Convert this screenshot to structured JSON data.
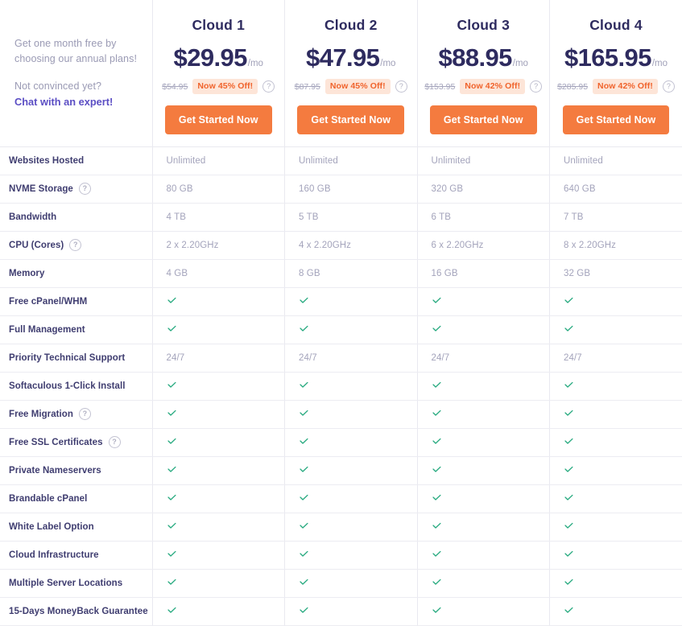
{
  "promo": {
    "line1": "Get one month free by",
    "line2": "choosing our annual plans!",
    "line3": "Not convinced yet?",
    "link": "Chat with an expert!"
  },
  "colors": {
    "accent_orange": "#f47b3f",
    "badge_bg": "#fde5d8",
    "badge_text": "#f0632c",
    "link_purple": "#5b4ec4",
    "heading_navy": "#2e2b5f",
    "check_green": "#25a97e",
    "muted_text": "#a3a3bb"
  },
  "plans": [
    {
      "name": "Cloud 1",
      "price": "$29.95",
      "period": "/mo",
      "old_price": "$54.95",
      "discount": "Now 45% Off!",
      "cta": "Get Started Now"
    },
    {
      "name": "Cloud 2",
      "price": "$47.95",
      "period": "/mo",
      "old_price": "$87.95",
      "discount": "Now 45% Off!",
      "cta": "Get Started Now"
    },
    {
      "name": "Cloud 3",
      "price": "$88.95",
      "period": "/mo",
      "old_price": "$153.95",
      "discount": "Now 42% Off!",
      "cta": "Get Started Now"
    },
    {
      "name": "Cloud 4",
      "price": "$165.95",
      "period": "/mo",
      "old_price": "$285.95",
      "discount": "Now 42% Off!",
      "cta": "Get Started Now"
    }
  ],
  "help_glyph": "?",
  "features": [
    {
      "label": "Websites Hosted",
      "help": false,
      "type": "text",
      "values": [
        "Unlimited",
        "Unlimited",
        "Unlimited",
        "Unlimited"
      ]
    },
    {
      "label": "NVME Storage",
      "help": true,
      "type": "text",
      "values": [
        "80 GB",
        "160 GB",
        "320 GB",
        "640 GB"
      ]
    },
    {
      "label": "Bandwidth",
      "help": false,
      "type": "text",
      "values": [
        "4 TB",
        "5 TB",
        "6 TB",
        "7 TB"
      ]
    },
    {
      "label": "CPU (Cores)",
      "help": true,
      "type": "text",
      "values": [
        "2 x 2.20GHz",
        "4 x 2.20GHz",
        "6 x 2.20GHz",
        "8 x 2.20GHz"
      ]
    },
    {
      "label": "Memory",
      "help": false,
      "type": "text",
      "values": [
        "4 GB",
        "8 GB",
        "16 GB",
        "32 GB"
      ]
    },
    {
      "label": "Free cPanel/WHM",
      "help": false,
      "type": "check",
      "values": [
        true,
        true,
        true,
        true
      ]
    },
    {
      "label": "Full Management",
      "help": false,
      "type": "check",
      "values": [
        true,
        true,
        true,
        true
      ]
    },
    {
      "label": "Priority Technical Support",
      "help": false,
      "type": "text",
      "values": [
        "24/7",
        "24/7",
        "24/7",
        "24/7"
      ]
    },
    {
      "label": "Softaculous 1-Click Install",
      "help": false,
      "type": "check",
      "values": [
        true,
        true,
        true,
        true
      ]
    },
    {
      "label": "Free Migration",
      "help": true,
      "type": "check",
      "values": [
        true,
        true,
        true,
        true
      ]
    },
    {
      "label": "Free SSL Certificates",
      "help": true,
      "type": "check",
      "values": [
        true,
        true,
        true,
        true
      ]
    },
    {
      "label": "Private Nameservers",
      "help": false,
      "type": "check",
      "values": [
        true,
        true,
        true,
        true
      ]
    },
    {
      "label": "Brandable cPanel",
      "help": false,
      "type": "check",
      "values": [
        true,
        true,
        true,
        true
      ]
    },
    {
      "label": "White Label Option",
      "help": false,
      "type": "check",
      "values": [
        true,
        true,
        true,
        true
      ]
    },
    {
      "label": "Cloud Infrastructure",
      "help": false,
      "type": "check",
      "values": [
        true,
        true,
        true,
        true
      ]
    },
    {
      "label": "Multiple Server Locations",
      "help": false,
      "type": "check",
      "values": [
        true,
        true,
        true,
        true
      ]
    },
    {
      "label": "15-Days MoneyBack Guarantee",
      "help": false,
      "type": "check",
      "values": [
        true,
        true,
        true,
        true
      ]
    }
  ]
}
